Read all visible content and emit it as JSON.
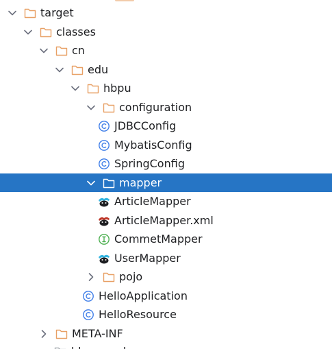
{
  "tree": {
    "items": [
      {
        "label": "target",
        "expanded": true,
        "icon": "folder-icon"
      },
      {
        "label": "classes",
        "expanded": true,
        "icon": "folder-icon"
      },
      {
        "label": "cn",
        "expanded": true,
        "icon": "folder-icon"
      },
      {
        "label": "edu",
        "expanded": true,
        "icon": "folder-icon"
      },
      {
        "label": "hbpu",
        "expanded": true,
        "icon": "folder-icon"
      },
      {
        "label": "configuration",
        "expanded": true,
        "icon": "folder-icon"
      },
      {
        "label": "JDBCConfig",
        "icon": "class-icon"
      },
      {
        "label": "MybatisConfig",
        "icon": "class-icon"
      },
      {
        "label": "SpringConfig",
        "icon": "class-icon"
      },
      {
        "label": "mapper",
        "expanded": true,
        "selected": true,
        "icon": "folder-icon"
      },
      {
        "label": "ArticleMapper",
        "icon": "mybatis-mapper-icon"
      },
      {
        "label": "ArticleMapper.xml",
        "icon": "mybatis-xml-icon"
      },
      {
        "label": "CommetMapper",
        "icon": "interface-icon"
      },
      {
        "label": "UserMapper",
        "icon": "mybatis-mapper-icon"
      },
      {
        "label": "pojo",
        "expanded": false,
        "icon": "folder-icon"
      },
      {
        "label": "HelloApplication",
        "icon": "class-icon"
      },
      {
        "label": "HelloResource",
        "icon": "class-icon"
      },
      {
        "label": "META-INF",
        "expanded": false,
        "icon": "folder-icon"
      }
    ],
    "partial_bottom_label": "hbpu-work"
  },
  "colors": {
    "selection": "#2675c5",
    "folder": "#e8a065",
    "class": "#3f7ee8",
    "interface": "#4caf50",
    "chevron": "#6c707e",
    "mybatis_blue": "#35b5e0",
    "mybatis_red": "#c0392b"
  }
}
